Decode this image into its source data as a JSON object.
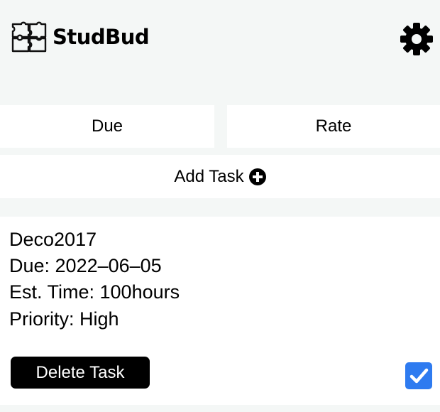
{
  "header": {
    "brand": "StudBud",
    "logo_icon": "puzzle-pieces-icon",
    "settings_icon": "gear-icon"
  },
  "sort": {
    "due_label": "Due",
    "rate_label": "Rate"
  },
  "add_task": {
    "label": "Add Task",
    "icon": "plus-circle-icon"
  },
  "task": {
    "name": "Deco2017",
    "due": "Due: 2022–06–05",
    "est_time": "Est. Time: 100hours",
    "priority": "Priority: High",
    "delete_label": "Delete Task",
    "completed": true
  },
  "colors": {
    "background": "#f4f7f6",
    "panel": "#ffffff",
    "checkbox": "#2e7bf0"
  }
}
